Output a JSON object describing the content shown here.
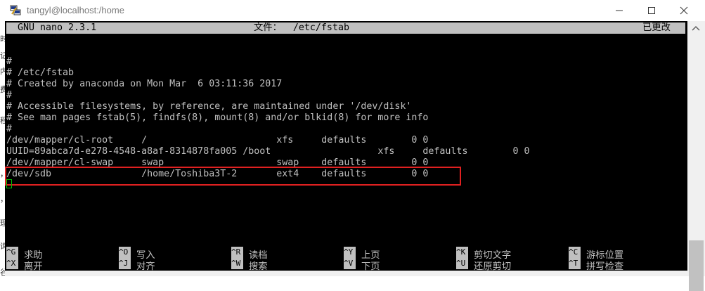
{
  "window": {
    "title": "tangyl@localhost:/home"
  },
  "left_strip_fragments": [
    "时",
    "记",
    "内",
    "费",
    "程",
    "，",
    "，",
    "理",
    "询",
    "谷"
  ],
  "nano": {
    "version": "GNU nano 2.3.1",
    "file_label": "文件：  /etc/fstab",
    "status": "已更改"
  },
  "file_lines": [
    "#",
    "# /etc/fstab",
    "# Created by anaconda on Mon Mar  6 03:11:36 2017",
    "#",
    "# Accessible filesystems, by reference, are maintained under '/dev/disk'",
    "# See man pages fstab(5), findfs(8), mount(8) and/or blkid(8) for more info",
    "#",
    "/dev/mapper/cl-root     /                       xfs     defaults        0 0",
    "UUID=89abca7d-e278-4548-a8af-8314878fa005 /boot                   xfs     defaults        0 0",
    "/dev/mapper/cl-swap     swap                    swap    defaults        0 0",
    "/dev/sdb                /home/Toshiba3T-2       ext4    defaults        0 0"
  ],
  "shortcuts": [
    {
      "key": "^G",
      "label": "求助"
    },
    {
      "key": "^O",
      "label": "写入"
    },
    {
      "key": "^R",
      "label": "读档"
    },
    {
      "key": "^Y",
      "label": "上页"
    },
    {
      "key": "^K",
      "label": "剪切文字"
    },
    {
      "key": "^C",
      "label": "游标位置"
    },
    {
      "key": "^X",
      "label": "离开"
    },
    {
      "key": "^J",
      "label": "对齐"
    },
    {
      "key": "^W",
      "label": "搜索"
    },
    {
      "key": "^V",
      "label": "下页"
    },
    {
      "key": "^U",
      "label": "还原剪切"
    },
    {
      "key": "^T",
      "label": "拼写检查"
    }
  ],
  "colors": {
    "terminal_bg": "#000000",
    "terminal_fg": "#c0c0c0",
    "header_bg": "#c0c0c0",
    "highlight": "#e02020",
    "cursor": "#00c000"
  }
}
